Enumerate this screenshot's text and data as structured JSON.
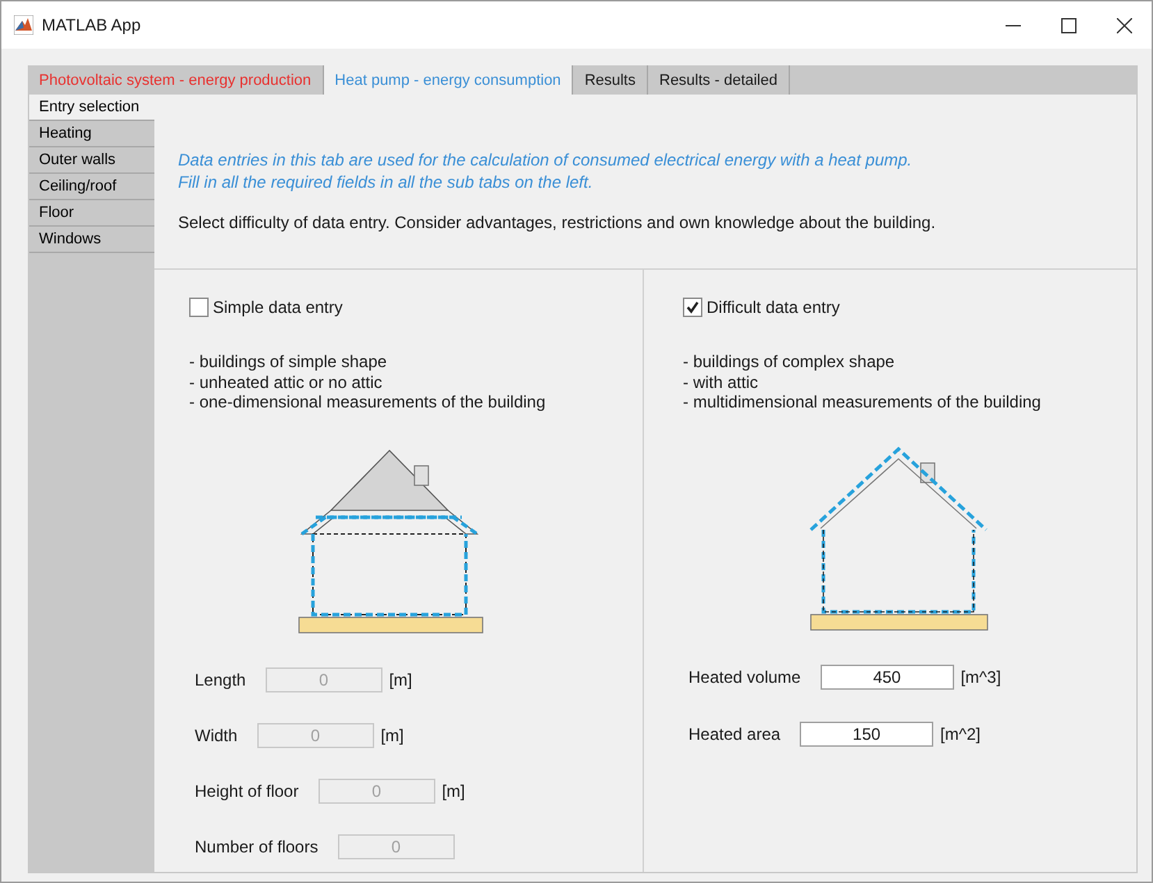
{
  "window": {
    "title": "MATLAB App"
  },
  "tabs": [
    {
      "label": "Photovoltaic system - energy production",
      "selected": false,
      "color": "#e8312f"
    },
    {
      "label": "Heat pump - energy consumption",
      "selected": true,
      "color": "#3a8fd6"
    },
    {
      "label": "Results",
      "selected": false,
      "color": "#1a1a1a"
    },
    {
      "label": "Results - detailed",
      "selected": false,
      "color": "#1a1a1a"
    }
  ],
  "sub_tabs": [
    {
      "label": "Entry selection",
      "selected": true
    },
    {
      "label": "Heating",
      "selected": false
    },
    {
      "label": "Outer walls",
      "selected": false
    },
    {
      "label": "Ceiling/roof",
      "selected": false
    },
    {
      "label": "Floor",
      "selected": false
    },
    {
      "label": "Windows",
      "selected": false
    }
  ],
  "intro": {
    "info_lines": [
      "Data entries in this tab are used for the calculation of consumed electrical energy with a heat pump.",
      "Fill in all the required fields in all the sub tabs on the left."
    ],
    "instruction": "Select difficulty of data entry. Consider advantages, restrictions and own knowledge about the building."
  },
  "panels": [
    {
      "kind": "simple",
      "label": "Simple data entry",
      "checked": false,
      "bullets": [
        "- buildings of simple shape",
        "- unheated attic or no attic",
        "- one-dimensional measurements of the building"
      ],
      "fields": [
        {
          "label": "Length",
          "value": "0",
          "unit": "[m]",
          "disabled": true
        },
        {
          "label": "Width",
          "value": "0",
          "unit": "[m]",
          "disabled": true
        },
        {
          "label": "Height of floor",
          "value": "0",
          "unit": "[m]",
          "disabled": true
        },
        {
          "label": "Number of floors",
          "value": "0",
          "disabled": true
        }
      ]
    },
    {
      "kind": "difficult",
      "label": "Difficult data entry",
      "checked": true,
      "bullets": [
        "- buildings of complex shape",
        "- with attic",
        "- multidimensional measurements of the building"
      ],
      "fields": [
        {
          "label": "Heated volume",
          "value": "450",
          "unit": "[m^3]",
          "disabled": false
        },
        {
          "label": "Heated area",
          "value": "150",
          "unit": "[m^2]",
          "disabled": false
        }
      ]
    }
  ]
}
